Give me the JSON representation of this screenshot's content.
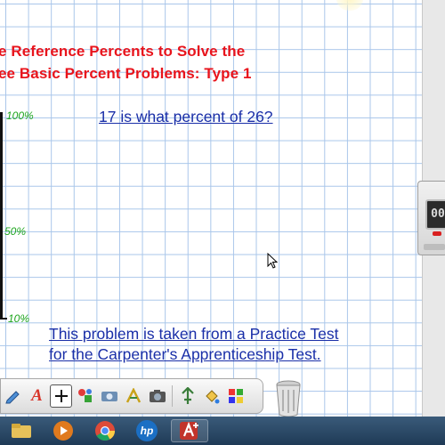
{
  "board": {
    "title_line_1": "e Reference Percents to Solve the",
    "title_line_2": "ee Basic Percent Problems: Type 1",
    "question": "17 is what percent of 26?",
    "scale": {
      "label_100": "100%",
      "label_50": "50%",
      "label_10": "10%"
    },
    "note_line_1": "This problem is taken from a Practice Test",
    "note_line_2": "for the Carpenter's Apprenticeship Test."
  },
  "timer": {
    "display": "00"
  },
  "toolbar": {
    "tools": [
      "pen-icon",
      "text-tool-icon",
      "select-cross-icon",
      "shapes-icon",
      "screen-capture-icon",
      "recognize-text-icon",
      "camera-icon",
      "move-tool-icon",
      "fill-tool-icon",
      "color-palette-icon"
    ],
    "text_tool_glyph": "A"
  },
  "taskbar": {
    "apps": [
      "windows-explorer-icon",
      "media-player-icon",
      "chrome-icon",
      "hp-icon",
      "smart-notebook-icon"
    ],
    "hp_label": "hp"
  },
  "colors": {
    "title": "#e8141c",
    "question": "#1a2fa8",
    "percent_labels": "#1ea51e",
    "grid": "#a9c6ea"
  }
}
